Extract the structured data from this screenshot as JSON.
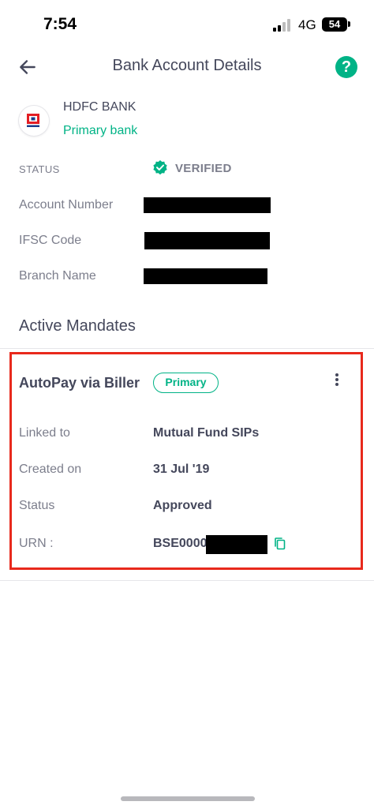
{
  "status_bar": {
    "time": "7:54",
    "network": "4G",
    "battery": "54"
  },
  "header": {
    "title": "Bank Account Details",
    "back_icon": "arrow-left-icon",
    "help_icon": "question-circle-icon",
    "help_symbol": "?"
  },
  "bank": {
    "name": "HDFC BANK",
    "tag": "Primary bank",
    "logo_icon": "hdfc-logo-icon"
  },
  "account": {
    "status_label": "STATUS",
    "status_value": "VERIFIED",
    "account_number_label": "Account Number",
    "ifsc_label": "IFSC Code",
    "branch_label": "Branch Name"
  },
  "mandates": {
    "section_title": "Active Mandates",
    "items": [
      {
        "title": "AutoPay via Biller",
        "badge": "Primary",
        "linked_to_label": "Linked to",
        "linked_to_value": "Mutual Fund SIPs",
        "created_on_label": "Created on",
        "created_on_value": "31 Jul '19",
        "status_label": "Status",
        "status_value": "Approved",
        "urn_label": "URN :",
        "urn_value": "BSE0000"
      }
    ]
  },
  "colors": {
    "accent": "#00b386",
    "highlight": "#e8291c",
    "text_primary": "#44475b",
    "text_secondary": "#7c7e8c"
  }
}
